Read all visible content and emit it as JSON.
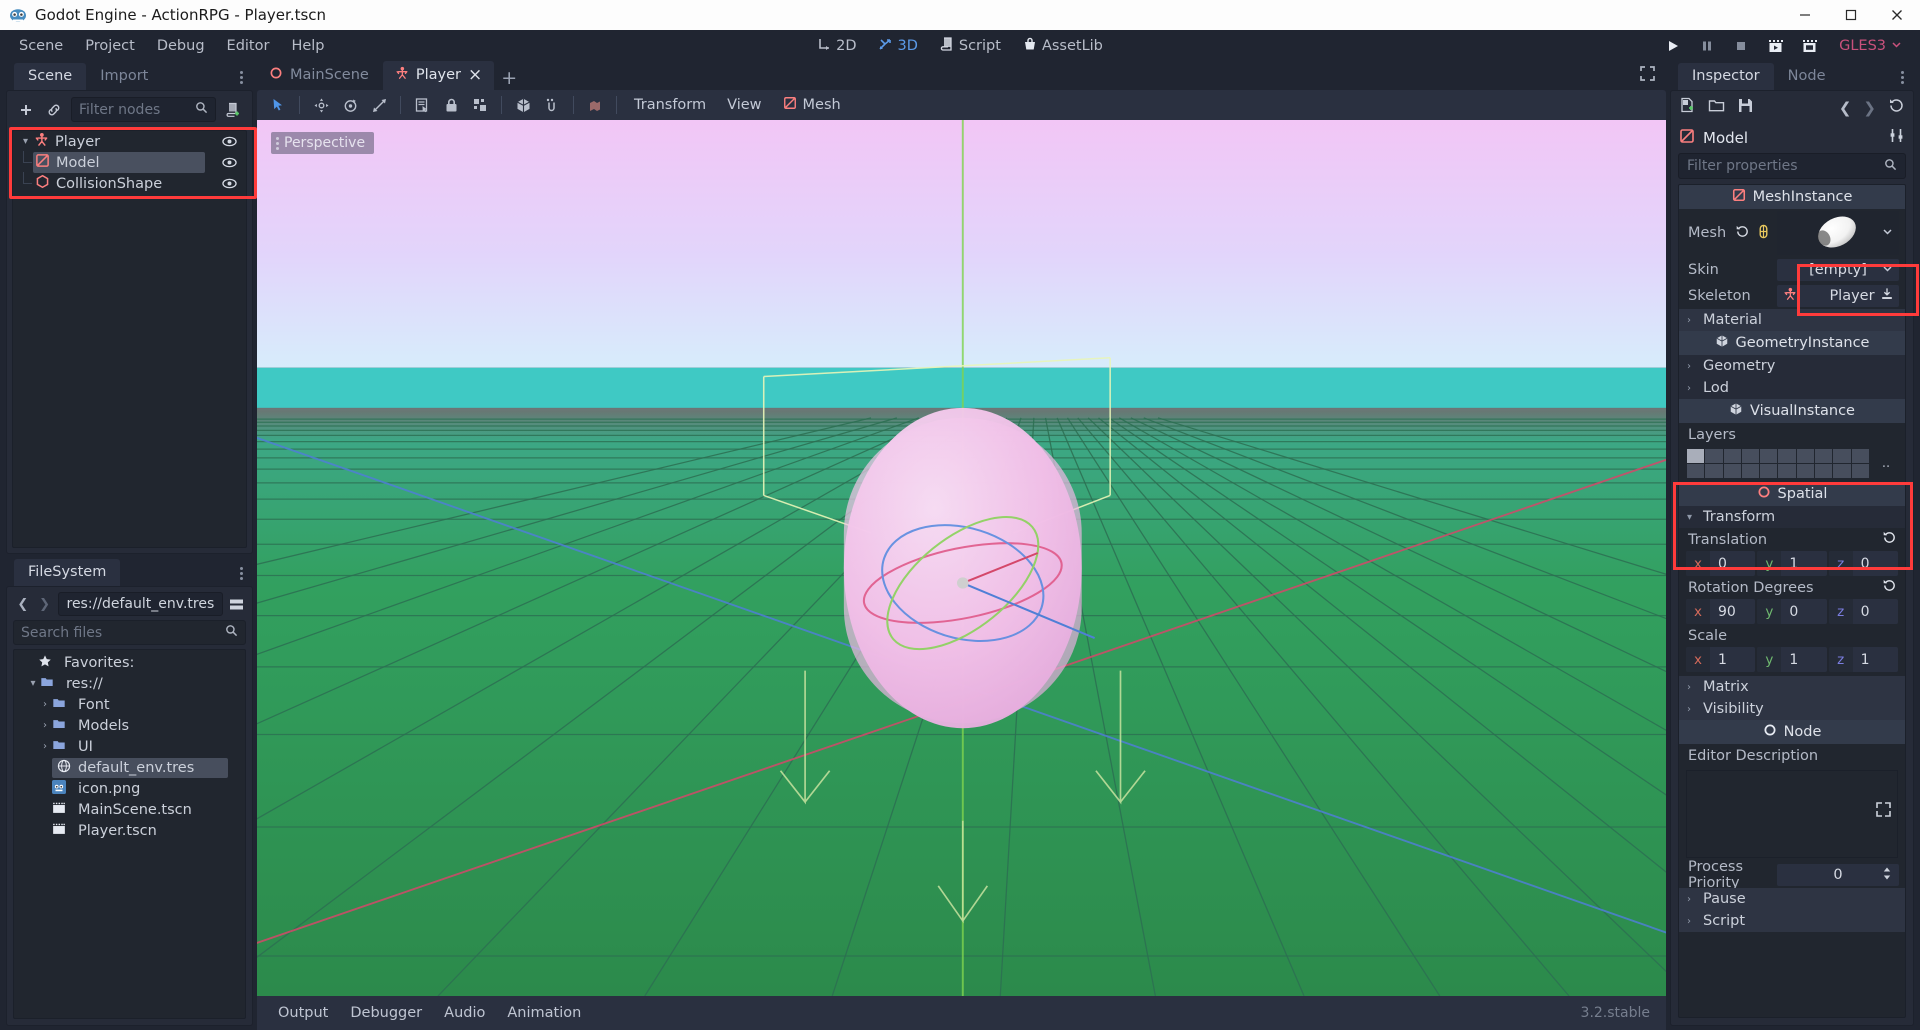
{
  "window": {
    "title": "Godot Engine - ActionRPG - Player.tscn",
    "minimize": "–",
    "maximize": "□",
    "close": "×"
  },
  "menubar": {
    "items": [
      "Scene",
      "Project",
      "Debug",
      "Editor",
      "Help"
    ],
    "modes": [
      {
        "label": "2D",
        "icon": "axis-2d-icon",
        "active": false
      },
      {
        "label": "3D",
        "icon": "axis-3d-icon",
        "active": true
      },
      {
        "label": "Script",
        "icon": "script-icon",
        "active": false
      },
      {
        "label": "AssetLib",
        "icon": "assetlib-icon",
        "active": false
      }
    ],
    "playback": [
      {
        "name": "play-button",
        "icon": "play-icon"
      },
      {
        "name": "pause-button",
        "icon": "pause-icon"
      },
      {
        "name": "stop-button",
        "icon": "stop-icon"
      },
      {
        "name": "play-scene-button",
        "icon": "play-scene-icon"
      },
      {
        "name": "play-custom-scene-button",
        "icon": "play-custom-icon"
      }
    ],
    "renderer": "GLES3"
  },
  "scene_dock": {
    "tabs": [
      {
        "label": "Scene",
        "active": true
      },
      {
        "label": "Import",
        "active": false
      }
    ],
    "toolbar": {
      "add_node": "+",
      "instance_icon": "link-icon",
      "filter_placeholder": "Filter nodes",
      "search_icon": "search-icon",
      "create_script_icon": "script-create-icon"
    },
    "tree": [
      {
        "label": "Player",
        "icon": "kinematicbody-icon",
        "depth": 0,
        "selected": false,
        "expanded": true,
        "visible_icon": "eye-icon"
      },
      {
        "label": "Model",
        "icon": "meshinstance-icon",
        "depth": 1,
        "selected": true,
        "expanded": false,
        "visible_icon": "eye-icon"
      },
      {
        "label": "CollisionShape",
        "icon": "collisionshape-icon",
        "depth": 1,
        "selected": false,
        "expanded": false,
        "visible_icon": "eye-icon"
      }
    ]
  },
  "filesystem_dock": {
    "tabs": [
      {
        "label": "FileSystem",
        "active": true
      }
    ],
    "path": "res://default_env.tres",
    "search_placeholder": "Search files",
    "back_icon": "chevron-left-icon",
    "forward_icon": "chevron-right-icon",
    "split_mode_icon": "split-mode-icon",
    "items": [
      {
        "label": "Favorites:",
        "icon": "star-icon",
        "depth": 0,
        "type": "favorites",
        "selected": false
      },
      {
        "label": "res://",
        "icon": "folder-icon",
        "depth": 0,
        "type": "folder",
        "expanded": true,
        "selected": false
      },
      {
        "label": "Font",
        "icon": "folder-icon",
        "depth": 1,
        "type": "folder",
        "expanded": false,
        "selected": false
      },
      {
        "label": "Models",
        "icon": "folder-icon",
        "depth": 1,
        "type": "folder",
        "expanded": false,
        "selected": false
      },
      {
        "label": "UI",
        "icon": "folder-icon",
        "depth": 1,
        "type": "folder",
        "expanded": false,
        "selected": false
      },
      {
        "label": "default_env.tres",
        "icon": "environment-icon",
        "depth": 1,
        "type": "file",
        "selected": true
      },
      {
        "label": "icon.png",
        "icon": "godot-icon",
        "depth": 1,
        "type": "file",
        "selected": false
      },
      {
        "label": "MainScene.tscn",
        "icon": "packedscene-icon",
        "depth": 1,
        "type": "file",
        "selected": false
      },
      {
        "label": "Player.tscn",
        "icon": "packedscene-icon",
        "depth": 1,
        "type": "file",
        "selected": false
      }
    ]
  },
  "editor": {
    "scene_tabs": [
      {
        "label": "MainScene",
        "icon": "spatial-icon",
        "active": false,
        "closable": false
      },
      {
        "label": "Player",
        "icon": "kinematicbody-icon",
        "active": true,
        "closable": true,
        "close": "×"
      }
    ],
    "add_tab": "+",
    "distraction_free_icon": "distraction-free-icon",
    "viewport_toolbar": {
      "tools": [
        {
          "name": "select-mode-button",
          "icon": "cursor-icon",
          "active": true
        },
        {
          "name": "move-mode-button",
          "icon": "move-icon",
          "active": false
        },
        {
          "name": "rotate-mode-button",
          "icon": "rotate-icon",
          "active": false
        },
        {
          "name": "scale-mode-button",
          "icon": "scale-icon",
          "active": false
        },
        {
          "name": "list-select-button",
          "icon": "list-select-icon",
          "active": false
        },
        {
          "name": "lock-button",
          "icon": "lock-icon",
          "active": false
        },
        {
          "name": "group-button",
          "icon": "group-icon",
          "active": false
        },
        {
          "name": "local-space-button",
          "icon": "local-space-icon",
          "active": false
        },
        {
          "name": "snap-button",
          "icon": "snap-icon",
          "active": false
        },
        {
          "name": "camera-preview-button",
          "icon": "camera-icon",
          "active": false
        }
      ],
      "menus": [
        {
          "label": "Transform",
          "icon": null
        },
        {
          "label": "View",
          "icon": null
        },
        {
          "label": "Mesh",
          "icon": "meshinstance-icon"
        }
      ]
    },
    "viewport_label": "Perspective"
  },
  "bottom_dock": {
    "tabs": [
      "Output",
      "Debugger",
      "Audio",
      "Animation"
    ],
    "version": "3.2.stable"
  },
  "inspector": {
    "tabs": [
      {
        "label": "Inspector",
        "active": true
      },
      {
        "label": "Node",
        "active": false
      }
    ],
    "toolbar": {
      "new_resource_icon": "new-resource-icon",
      "load_icon": "folder-open-icon",
      "save_icon": "save-icon",
      "back_icon": "chevron-left-icon",
      "forward_icon": "chevron-right-icon",
      "history_icon": "history-icon"
    },
    "object_name": "Model",
    "object_icon": "meshinstance-icon",
    "tools_icon": "object-tools-icon",
    "filter_placeholder": "Filter properties",
    "sections": [
      {
        "type": "category",
        "label": "MeshInstance",
        "icon": "meshinstance-icon"
      },
      {
        "type": "resource",
        "label": "Mesh",
        "value": "",
        "preview_icon": "capsule-mesh-preview",
        "reset_icon": "reset-icon",
        "type_icon": "capsulemesh-icon",
        "highlighted": true
      },
      {
        "type": "dropdown",
        "label": "Skin",
        "value": "[empty]"
      },
      {
        "type": "nodepath",
        "label": "Skeleton",
        "value": "Player",
        "icon": "kinematicbody-icon",
        "assign_icon": "assign-icon"
      },
      {
        "type": "group",
        "label": "Material",
        "expanded": false
      },
      {
        "type": "category",
        "label": "GeometryInstance",
        "icon": "geometry-icon"
      },
      {
        "type": "group",
        "label": "Geometry",
        "expanded": false
      },
      {
        "type": "group",
        "label": "Lod",
        "expanded": false
      },
      {
        "type": "category",
        "label": "VisualInstance",
        "icon": "geometry-icon"
      },
      {
        "type": "layers",
        "label": "Layers",
        "bits_on": [
          0
        ],
        "bits_total": 20,
        "more": ".."
      },
      {
        "type": "category",
        "label": "Spatial",
        "icon": "spatial-icon"
      },
      {
        "type": "group",
        "label": "Transform",
        "expanded": true
      },
      {
        "type": "vector3",
        "label": "Translation",
        "x": "0",
        "y": "1",
        "z": "0",
        "reset_icon": "reset-icon",
        "highlighted": true
      },
      {
        "type": "vector3",
        "label": "Rotation Degrees",
        "x": "90",
        "y": "0",
        "z": "0",
        "reset_icon": "reset-icon",
        "highlighted": true
      },
      {
        "type": "vector3",
        "label": "Scale",
        "x": "1",
        "y": "1",
        "z": "1"
      },
      {
        "type": "group",
        "label": "Matrix",
        "expanded": false
      },
      {
        "type": "group",
        "label": "Visibility",
        "expanded": false
      },
      {
        "type": "category",
        "label": "Node",
        "icon": "node-icon"
      },
      {
        "type": "textarea",
        "label": "Editor Description",
        "value": "",
        "expand_icon": "expand-icon"
      },
      {
        "type": "spin",
        "label": "Process Priority",
        "value": "0",
        "stepper_icon": "updown-icon"
      },
      {
        "type": "group",
        "label": "Pause",
        "expanded": false
      },
      {
        "type": "group",
        "label": "Script",
        "expanded": false
      }
    ],
    "labels": {
      "mesh": "Mesh",
      "skin": "Skin",
      "skeleton": "Skeleton",
      "layers": "Layers",
      "translation": "Translation",
      "rotation_degrees": "Rotation Degrees",
      "scale": "Scale",
      "editor_description": "Editor Description",
      "process_priority": "Process Priority"
    }
  },
  "colors": {
    "accent": "#5b9ae8",
    "highlight_red": "#ff3b3b",
    "panel_bg": "#262b38",
    "window_bg": "#202531",
    "renderer": "#c9517c"
  }
}
